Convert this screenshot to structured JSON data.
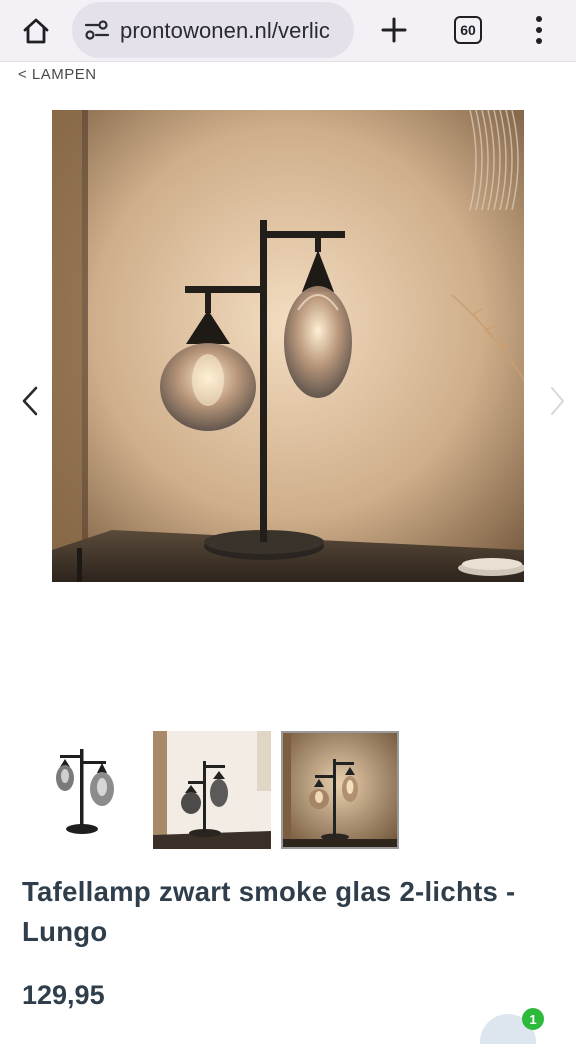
{
  "browser": {
    "url": "prontowonen.nl/verlic",
    "tab_count": "60",
    "icons": [
      "home-icon",
      "site-info-icon",
      "new-tab-icon",
      "tabs-icon",
      "more-menu-icon"
    ]
  },
  "breadcrumb": {
    "label": "< LAMPEN"
  },
  "product": {
    "title": "Tafellamp zwart smoke glas 2-lichts - Lungo",
    "price": "129,95",
    "gallery": {
      "thumbnail_count": 3,
      "selected_index": 3
    }
  },
  "chat": {
    "badge": "1"
  },
  "colors": {
    "title": "#2f3e4a",
    "badge": "#2dba3a",
    "browser_bar": "#f3f1f6"
  }
}
